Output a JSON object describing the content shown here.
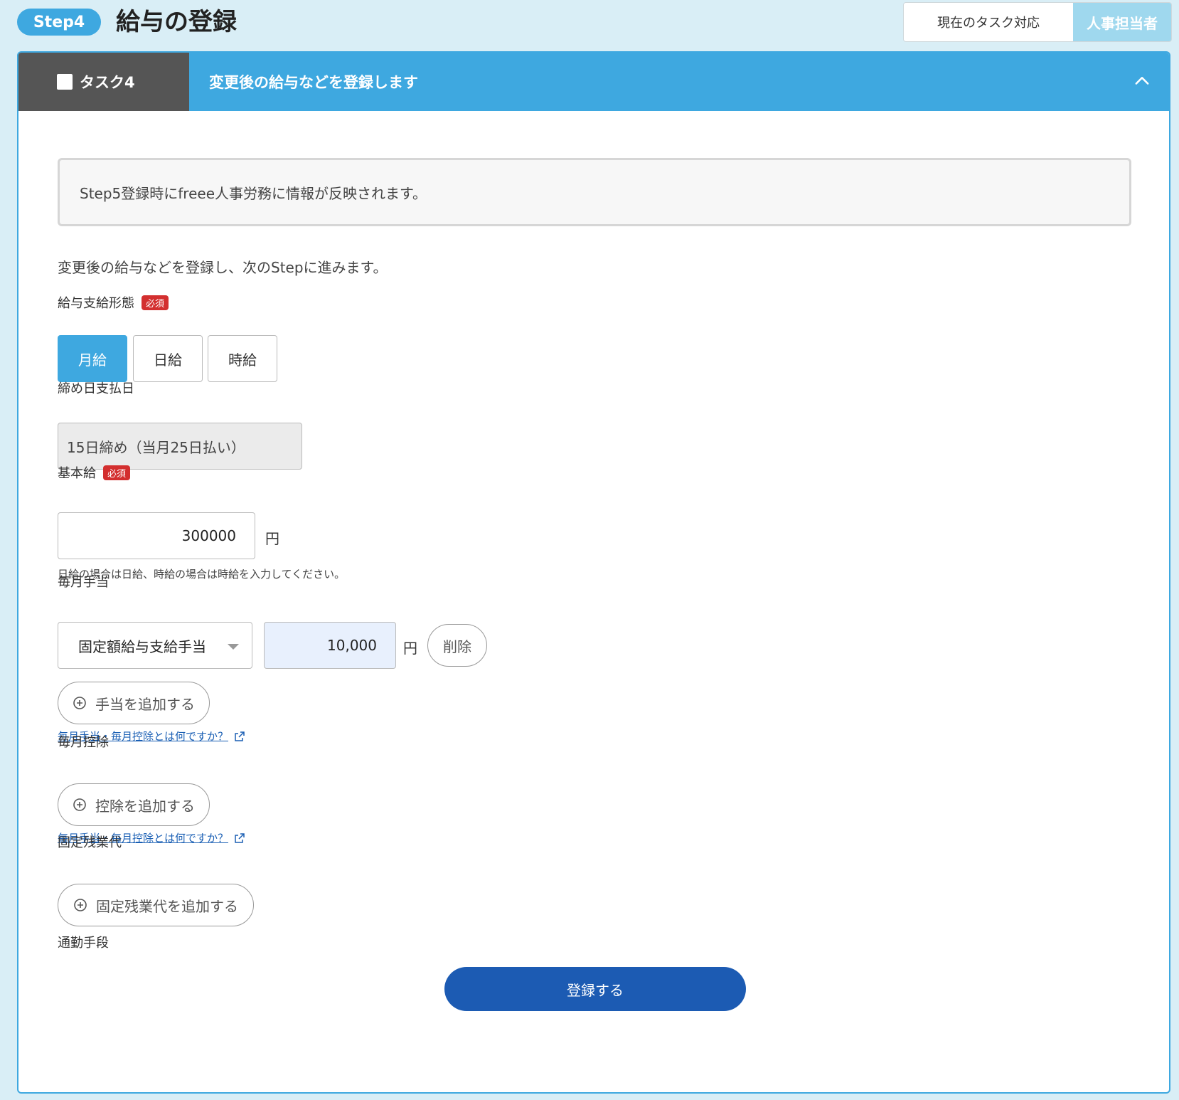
{
  "header": {
    "step_badge": "Step4",
    "title": "給与の登録",
    "role_toggle": {
      "current_task": "現在のタスク対応",
      "role": "人事担当者"
    }
  },
  "task": {
    "label": "タスク4",
    "title": "変更後の給与などを登録します"
  },
  "notice": "Step5登録時にfreee人事労務に情報が反映されます。",
  "intro": "変更後の給与などを登録し、次のStepに進みます。",
  "required_badge": "必須",
  "pay_type": {
    "label": "給与支給形態",
    "options": [
      "月給",
      "日給",
      "時給"
    ],
    "selected": "月給"
  },
  "closing_date": {
    "label": "締め日支払日",
    "value": "15日締め（当月25日払い）"
  },
  "base_salary": {
    "label": "基本給",
    "value": "300000",
    "unit": "円",
    "hint": "日給の場合は日給、時給の場合は時給を入力してください。"
  },
  "monthly_allowance": {
    "label": "毎月手当",
    "type": "固定額給与支給手当",
    "amount": "10,000",
    "unit": "円",
    "delete_label": "削除",
    "add_label": "手当を追加する",
    "help_link": "毎月手当・毎月控除とは何ですか？"
  },
  "monthly_deduction": {
    "label": "毎月控除",
    "add_label": "控除を追加する",
    "help_link": "毎月手当・毎月控除とは何ですか？"
  },
  "fixed_overtime": {
    "label": "固定残業代",
    "add_label": "固定残業代を追加する"
  },
  "commute": {
    "label": "通勤手段"
  },
  "submit_label": "登録する",
  "colors": {
    "accent": "#3ea8e0",
    "primary_button": "#1c5bb3",
    "required": "#d32f2f",
    "task_label_bg": "#555555"
  }
}
